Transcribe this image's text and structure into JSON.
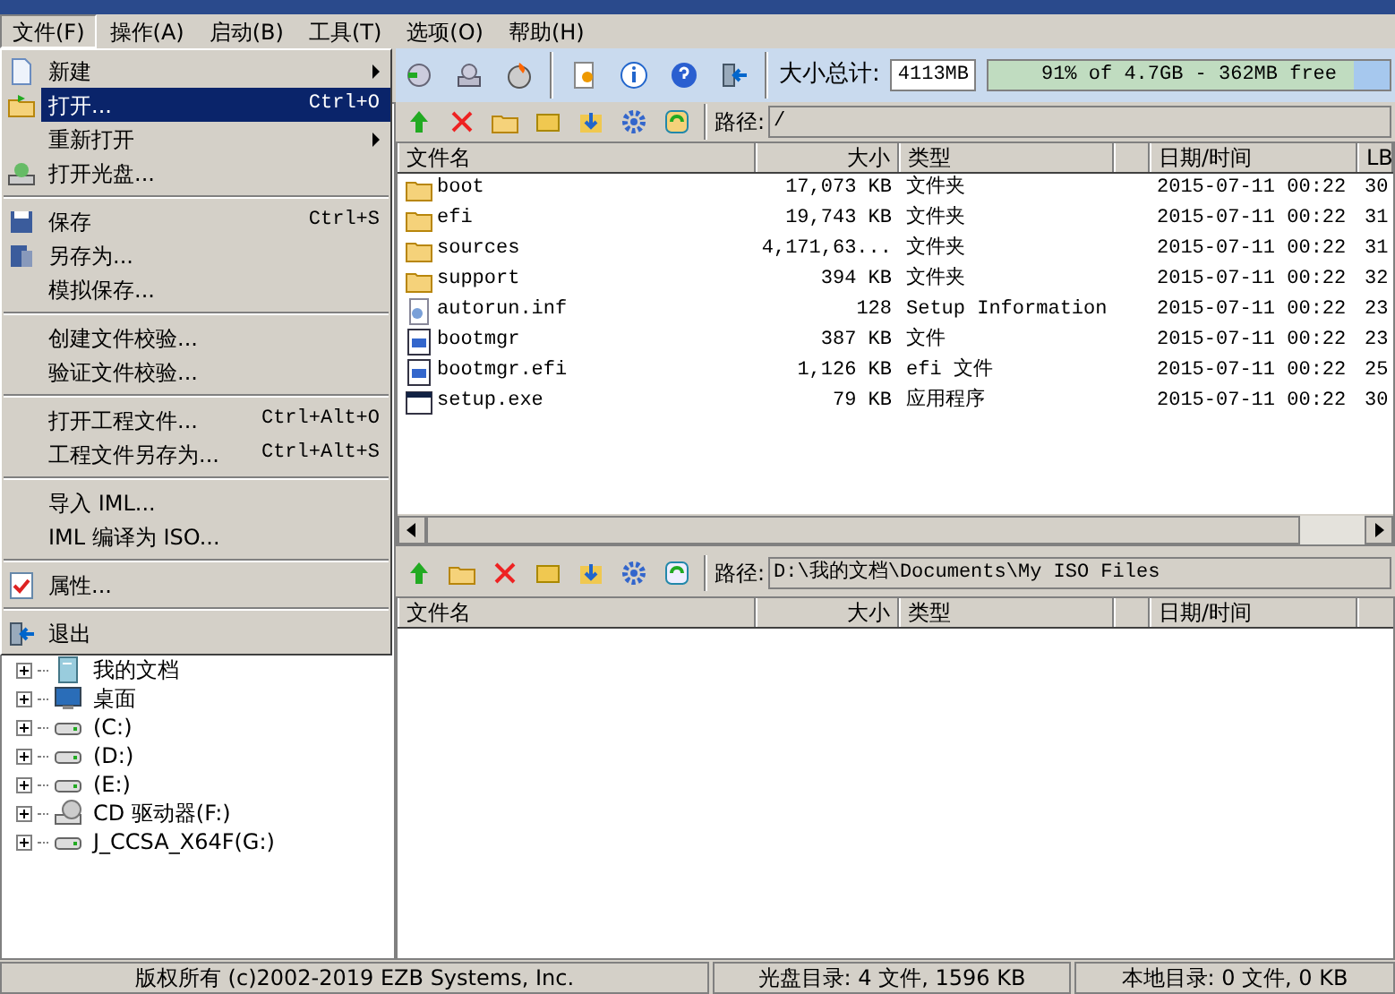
{
  "menu_bar": [
    {
      "label": "文件(F)",
      "selected": true
    },
    {
      "label": "操作(A)",
      "selected": false
    },
    {
      "label": "启动(B)",
      "selected": false
    },
    {
      "label": "工具(T)",
      "selected": false
    },
    {
      "label": "选项(O)",
      "selected": false
    },
    {
      "label": "帮助(H)",
      "selected": false
    }
  ],
  "file_menu": [
    {
      "kind": "item",
      "label": "新建",
      "submenu": true,
      "selected": false
    },
    {
      "kind": "item",
      "label": "打开...",
      "shortcut": "Ctrl+O",
      "selected": true
    },
    {
      "kind": "item",
      "label": "重新打开",
      "submenu": true,
      "selected": false
    },
    {
      "kind": "item",
      "label": "打开光盘...",
      "selected": false
    },
    {
      "kind": "separator"
    },
    {
      "kind": "item",
      "label": "保存",
      "shortcut": "Ctrl+S",
      "selected": false
    },
    {
      "kind": "item",
      "label": "另存为...",
      "selected": false
    },
    {
      "kind": "item",
      "label": "模拟保存...",
      "selected": false
    },
    {
      "kind": "separator"
    },
    {
      "kind": "item",
      "label": "创建文件校验...",
      "selected": false
    },
    {
      "kind": "item",
      "label": "验证文件校验...",
      "selected": false
    },
    {
      "kind": "separator"
    },
    {
      "kind": "item",
      "label": "打开工程文件...",
      "shortcut": "Ctrl+Alt+O",
      "selected": false
    },
    {
      "kind": "item",
      "label": "工程文件另存为...",
      "shortcut": "Ctrl+Alt+S",
      "selected": false
    },
    {
      "kind": "separator"
    },
    {
      "kind": "item",
      "label": "导入 IML...",
      "selected": false
    },
    {
      "kind": "item",
      "label": "IML 编译为 ISO...",
      "selected": false
    },
    {
      "kind": "separator"
    },
    {
      "kind": "item",
      "label": "属性...",
      "selected": false
    },
    {
      "kind": "separator"
    },
    {
      "kind": "item",
      "label": "退出",
      "selected": false
    }
  ],
  "size_total": {
    "label": "大小总计:",
    "value": "4113MB",
    "capacity": {
      "text": "91% of 4.7GB - 362MB free",
      "level": 0.91
    }
  },
  "iso_panel": {
    "path_label": "路径:",
    "path": "/",
    "columns": [
      "文件名",
      "大小",
      "类型",
      "",
      "日期/时间",
      "LB"
    ],
    "rows": [
      {
        "kind": "folder",
        "name": "boot",
        "size": "17,073 KB",
        "type": "文件夹",
        "date": "2015-07-11 00:22",
        "column_6": "30"
      },
      {
        "kind": "folder",
        "name": "efi",
        "size": "19,743 KB",
        "type": "文件夹",
        "date": "2015-07-11 00:22",
        "column_6": "31"
      },
      {
        "kind": "folder",
        "name": "sources",
        "size": "4,171,63...",
        "type": "文件夹",
        "date": "2015-07-11 00:22",
        "column_6": "31"
      },
      {
        "kind": "folder",
        "name": "support",
        "size": "394 KB",
        "type": "文件夹",
        "date": "2015-07-11 00:22",
        "column_6": "32"
      },
      {
        "kind": "settings",
        "name": "autorun.inf",
        "size": "128",
        "type": "Setup Information",
        "date": "2015-07-11 00:22",
        "column_6": "23"
      },
      {
        "kind": "file",
        "name": "bootmgr",
        "size": "387 KB",
        "type": "文件",
        "date": "2015-07-11 00:22",
        "column_6": "23"
      },
      {
        "kind": "file",
        "name": "bootmgr.efi",
        "size": "1,126 KB",
        "type": "efi 文件",
        "date": "2015-07-11 00:22",
        "column_6": "25"
      },
      {
        "kind": "program",
        "name": "setup.exe",
        "size": "79 KB",
        "type": "应用程序",
        "date": "2015-07-11 00:22",
        "column_6": "30"
      }
    ]
  },
  "local_panel": {
    "path_label": "路径:",
    "path": "D:\\我的文档\\Documents\\My ISO Files",
    "columns": [
      "文件名",
      "大小",
      "类型",
      "",
      "日期/时间"
    ]
  },
  "local_tree": [
    {
      "kind": "documents",
      "label": "我的文档"
    },
    {
      "kind": "desktop",
      "label": "桌面"
    },
    {
      "kind": "drive",
      "label": "(C:)"
    },
    {
      "kind": "drive",
      "label": "(D:)"
    },
    {
      "kind": "drive",
      "label": "(E:)"
    },
    {
      "kind": "cd",
      "label": "CD 驱动器(F:)"
    },
    {
      "kind": "drive",
      "label": "J_CCSA_X64F(G:)"
    }
  ],
  "status_bar": [
    "版权所有 (c)2002-2019 EZB Systems, Inc.",
    "光盘目录: 4 文件, 1596 KB",
    "本地目录: 0 文件, 0 KB"
  ]
}
